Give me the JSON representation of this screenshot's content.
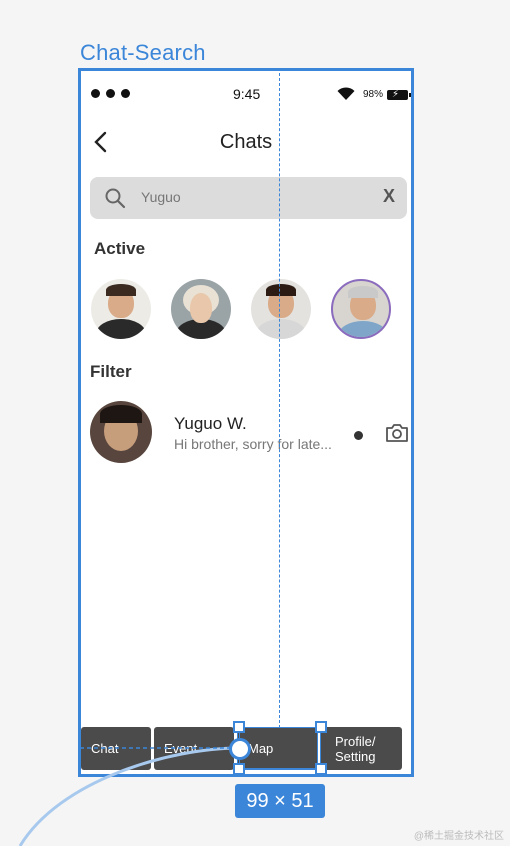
{
  "frame_label": "Chat-Search",
  "status_bar": {
    "time": "9:45",
    "battery": "98%"
  },
  "header": {
    "title": "Chats"
  },
  "search": {
    "value": "Yuguo",
    "clear_label": "X"
  },
  "sections": {
    "active": "Active",
    "filter": "Filter"
  },
  "active_avatars": [
    "avatar-1",
    "avatar-2",
    "avatar-3",
    "avatar-4"
  ],
  "chat_item": {
    "name": "Yuguo W.",
    "preview": "Hi brother, sorry for late..."
  },
  "tabbar": {
    "chat": "Chat",
    "event": "Event",
    "map": "Map",
    "profile_line1": "Profile/",
    "profile_line2": "Setting"
  },
  "dimension_badge": "99 × 51",
  "colors": {
    "accent": "#3b86d9",
    "tab_bg": "#4b4b4b",
    "search_bg": "#dcdcdc"
  },
  "watermark": "@稀土掘金技术社区"
}
